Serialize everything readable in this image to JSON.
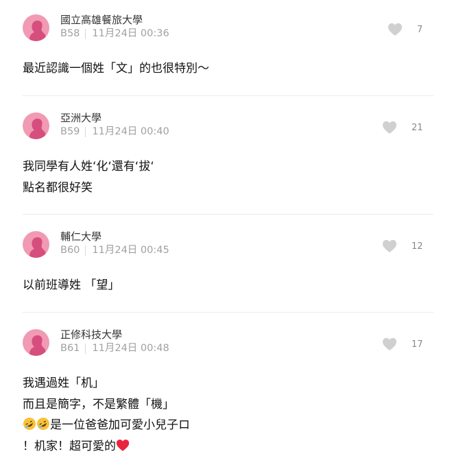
{
  "colors": {
    "avatar_bg": "#f19ab3",
    "avatar_figure": "#d64e7e",
    "like_icon": "#d0d0d0",
    "meta_text": "#a0a0a0",
    "heart_emoji": "#e8253d"
  },
  "comments": [
    {
      "school": "國立高雄餐旅大學",
      "floor": "B58",
      "time": "11月24日 00:36",
      "likes": "7",
      "lines": [
        "最近認識一個姓「文」的也很特別～"
      ]
    },
    {
      "school": "亞洲大學",
      "floor": "B59",
      "time": "11月24日 00:40",
      "likes": "21",
      "lines": [
        "我同學有人姓‘化‘還有‘拔‘",
        "點名都很好笑"
      ]
    },
    {
      "school": "輔仁大學",
      "floor": "B60",
      "time": "11月24日 00:45",
      "likes": "12",
      "lines": [
        "以前班導姓 「望」"
      ]
    },
    {
      "school": "正修科技大學",
      "floor": "B61",
      "time": "11月24日 00:48",
      "likes": "17",
      "lines": [
        "我遇過姓「机」",
        "而且是簡字，不是繁體「機」",
        "是一位爸爸加可愛小兒子",
        "！机家！超可愛的"
      ],
      "line3_prefix_emoji": "rolling-on-floor-laughing-emoji",
      "line3_suffix_glyph": "ロ",
      "line4_suffix_emoji": "red-heart-emoji"
    }
  ]
}
